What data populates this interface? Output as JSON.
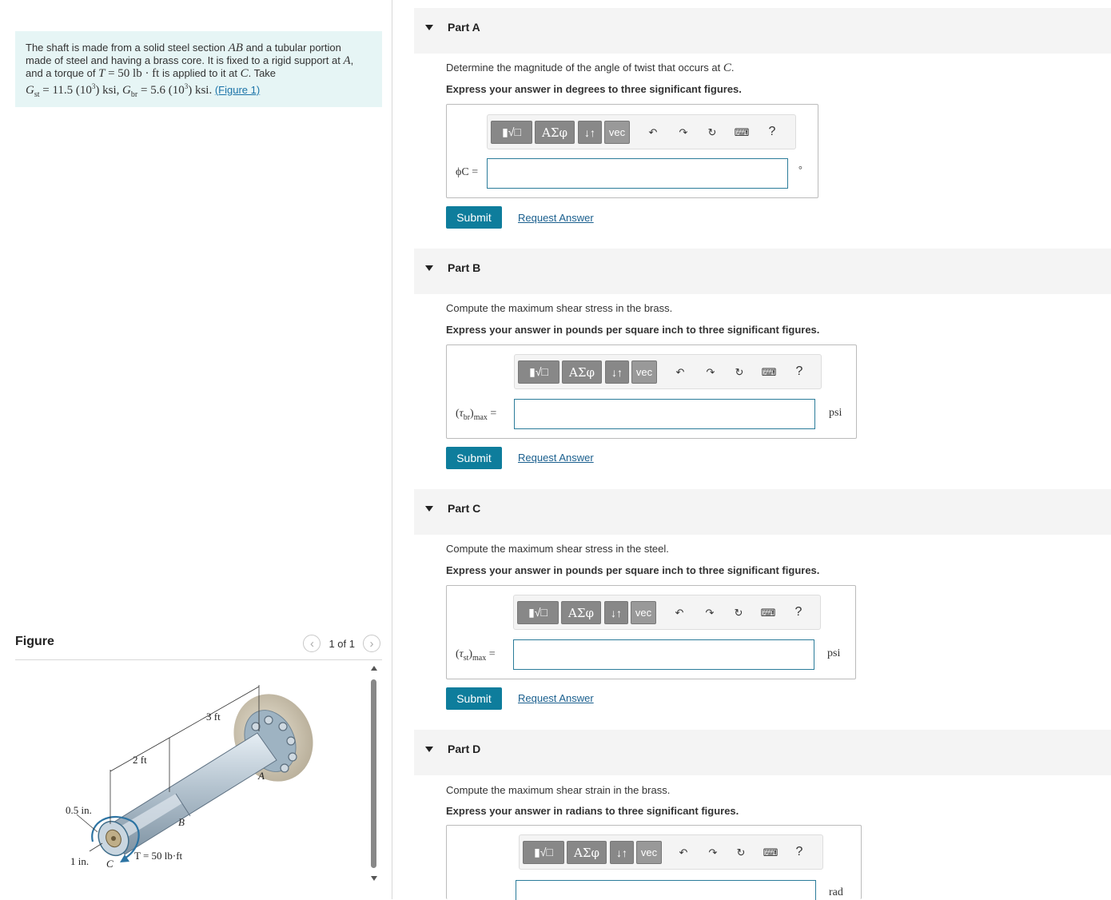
{
  "problem": {
    "line1": "The shaft is made from a solid steel section",
    "ab": "AB",
    "line1b": "and a tubular portion",
    "line2": "made of steel and having a brass core. It is fixed to a rigid support at",
    "a": "A",
    "line3a": "and a torque of",
    "torque_var": "T",
    "torque_val": "= 50 lb · ft",
    "line3b": "is applied to it at",
    "c": "C",
    "line3c": ". Take",
    "gst": "= 11.5 (10",
    "gst_exp": "3",
    "gst_unit": ") ksi,",
    "gbr": "= 5.6 (10",
    "gbr_exp": "3",
    "gbr_unit": ") ksi.",
    "figure_link": "(Figure 1)"
  },
  "figure": {
    "title": "Figure",
    "pager": "1 of 1",
    "labels": {
      "len3": "3 ft",
      "len2": "2 ft",
      "a": "A",
      "b": "B",
      "c": "C",
      "d05": "0.5 in.",
      "d1": "1 in.",
      "torque": "T = 50 lb·ft"
    }
  },
  "toolbar": {
    "greek": "ΑΣφ",
    "arrows": "↓↑",
    "vec": "vec",
    "help": "?"
  },
  "parts": [
    {
      "title": "Part A",
      "question_pre": "Determine the magnitude of the angle of twist that occurs at",
      "question_var": "C",
      "question_post": ".",
      "instruction": "Express your answer in degrees to three significant figures.",
      "label": "ϕC =",
      "unit": "°",
      "submit": "Submit",
      "request": "Request Answer"
    },
    {
      "title": "Part B",
      "question": "Compute the maximum shear stress in the brass.",
      "instruction": "Express your answer in pounds per square inch to three significant figures.",
      "label_sub": "br",
      "unit": "psi",
      "submit": "Submit",
      "request": "Request Answer"
    },
    {
      "title": "Part C",
      "question": "Compute the maximum shear stress in the steel.",
      "instruction": "Express your answer in pounds per square inch to three significant figures.",
      "label_sub": "st",
      "unit": "psi",
      "submit": "Submit",
      "request": "Request Answer"
    },
    {
      "title": "Part D",
      "question": "Compute the maximum shear strain in the brass.",
      "instruction": "Express your answer in radians to three significant figures.",
      "unit": "rad"
    }
  ],
  "colors": {
    "problem_bg": "#e6f5f5",
    "submit_bg": "#0e7d9c",
    "link": "#1a5f8e",
    "input_border": "#2b7c9a"
  }
}
